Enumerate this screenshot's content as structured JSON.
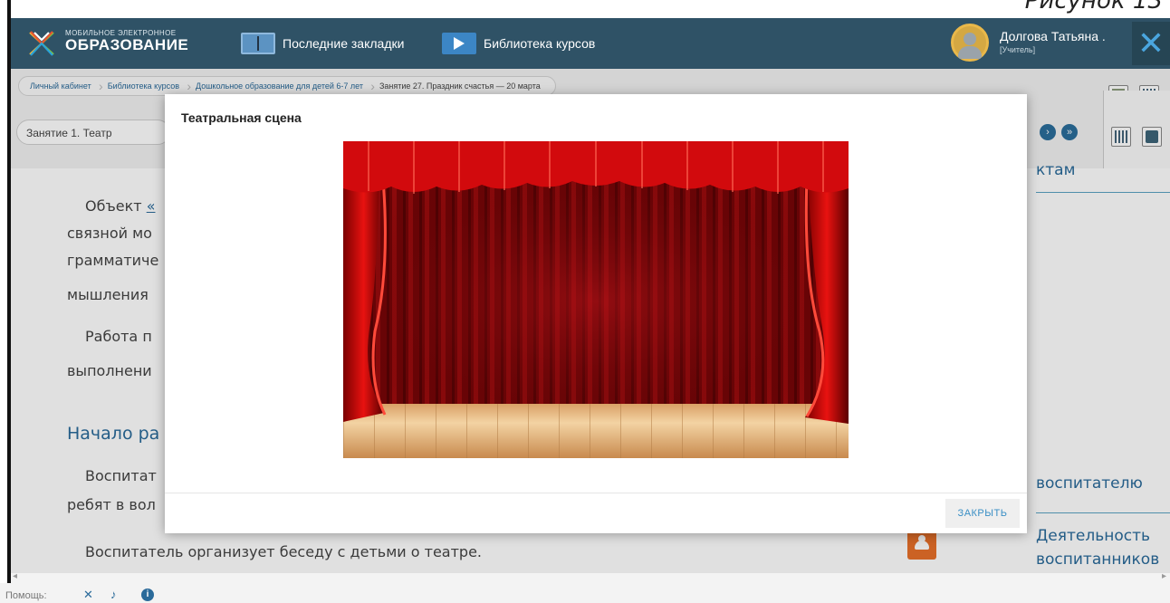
{
  "caption": "Рисунок 13",
  "header": {
    "logo_small": "МОБИЛЬНОЕ ЭЛЕКТРОННОЕ",
    "logo_big": "ОБРАЗОВАНИЕ",
    "nav_bookmarks": "Последние закладки",
    "nav_library": "Библиотека курсов",
    "user_name": "Долгова Татьяна .",
    "user_role": "[Учитель]"
  },
  "breadcrumb": [
    "Личный кабинет",
    "Библиотека курсов",
    "Дошкольное образование для детей 6-7 лет",
    "Занятие 27. Праздник счастья — 20 марта"
  ],
  "lesson_select": {
    "value": "Занятие 1. Театр"
  },
  "content": {
    "p1_start": "Объект ",
    "p1_link": "«",
    "line2": "связной мо",
    "line3": "грамматиче",
    "line4": "мышления",
    "p2_start": "Работа п",
    "line6": "выполнени",
    "heading": "Начало ра",
    "p3_start": "Воспитат",
    "line9": "ребят в вол",
    "p4": "Воспитатель организует беседу с детьми о театре."
  },
  "right_col": {
    "tail_top": "ктам",
    "educator": "воспитателю",
    "activity_line1": "Деятельность",
    "activity_line2": "воспитанников"
  },
  "modal": {
    "title": "Театральная сцена",
    "close_label": "ЗАКРЫТЬ"
  },
  "status": {
    "help_label": "Помощь:"
  },
  "colors": {
    "header_bg": "#2f5266",
    "accent_blue": "#2a6a9a",
    "curtain_red": "#c8060a",
    "activity_icon": "#e8702a"
  },
  "icons": [
    "logo-icon",
    "bookmarks-icon",
    "video-library-icon",
    "avatar",
    "close-icon",
    "prev-icon",
    "next-icon",
    "grid-icon",
    "chat-icon",
    "activity-icon",
    "tools-icon",
    "microphone-icon",
    "info-icon"
  ]
}
